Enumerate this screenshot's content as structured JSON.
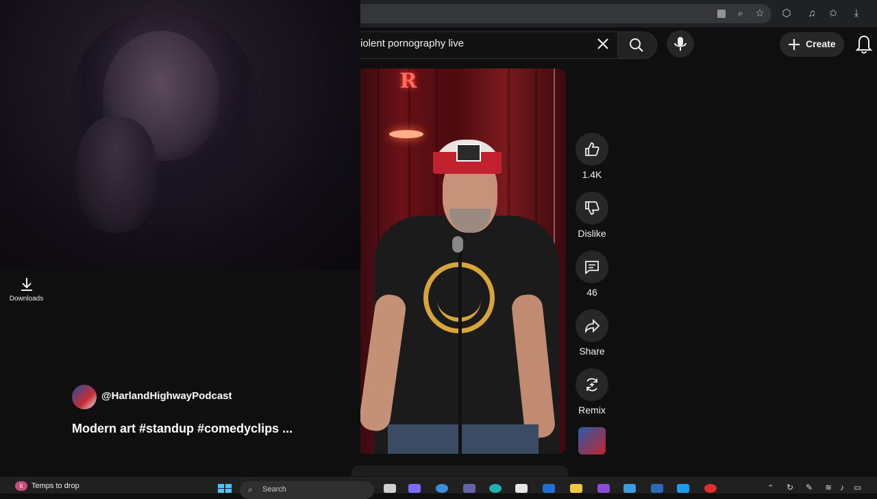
{
  "browser": {
    "toolbar_icons": [
      "apps-icon",
      "zoom-icon",
      "star-icon",
      "extensions-icon",
      "profile-sync-icon",
      "favorites-icon",
      "download-icon"
    ]
  },
  "header": {
    "search_value": "iolent pornography live",
    "create_label": "Create"
  },
  "sidebar": {
    "downloads_label": "Downloads"
  },
  "short": {
    "likes": "1.4K",
    "dislike_label": "Dislike",
    "comments": "46",
    "share_label": "Share",
    "remix_label": "Remix",
    "channel": "@HarlandHighwayPodcast",
    "title": "Modern art #standup #comedyclips ...",
    "sign_letter": "R"
  },
  "taskbar": {
    "notification_badge": "6",
    "weather_text": "Temps to drop",
    "search_placeholder": "Search"
  },
  "colors": {
    "accent_red": "#c1222e",
    "background": "#0f0f0f",
    "button_bg": "#272727"
  }
}
